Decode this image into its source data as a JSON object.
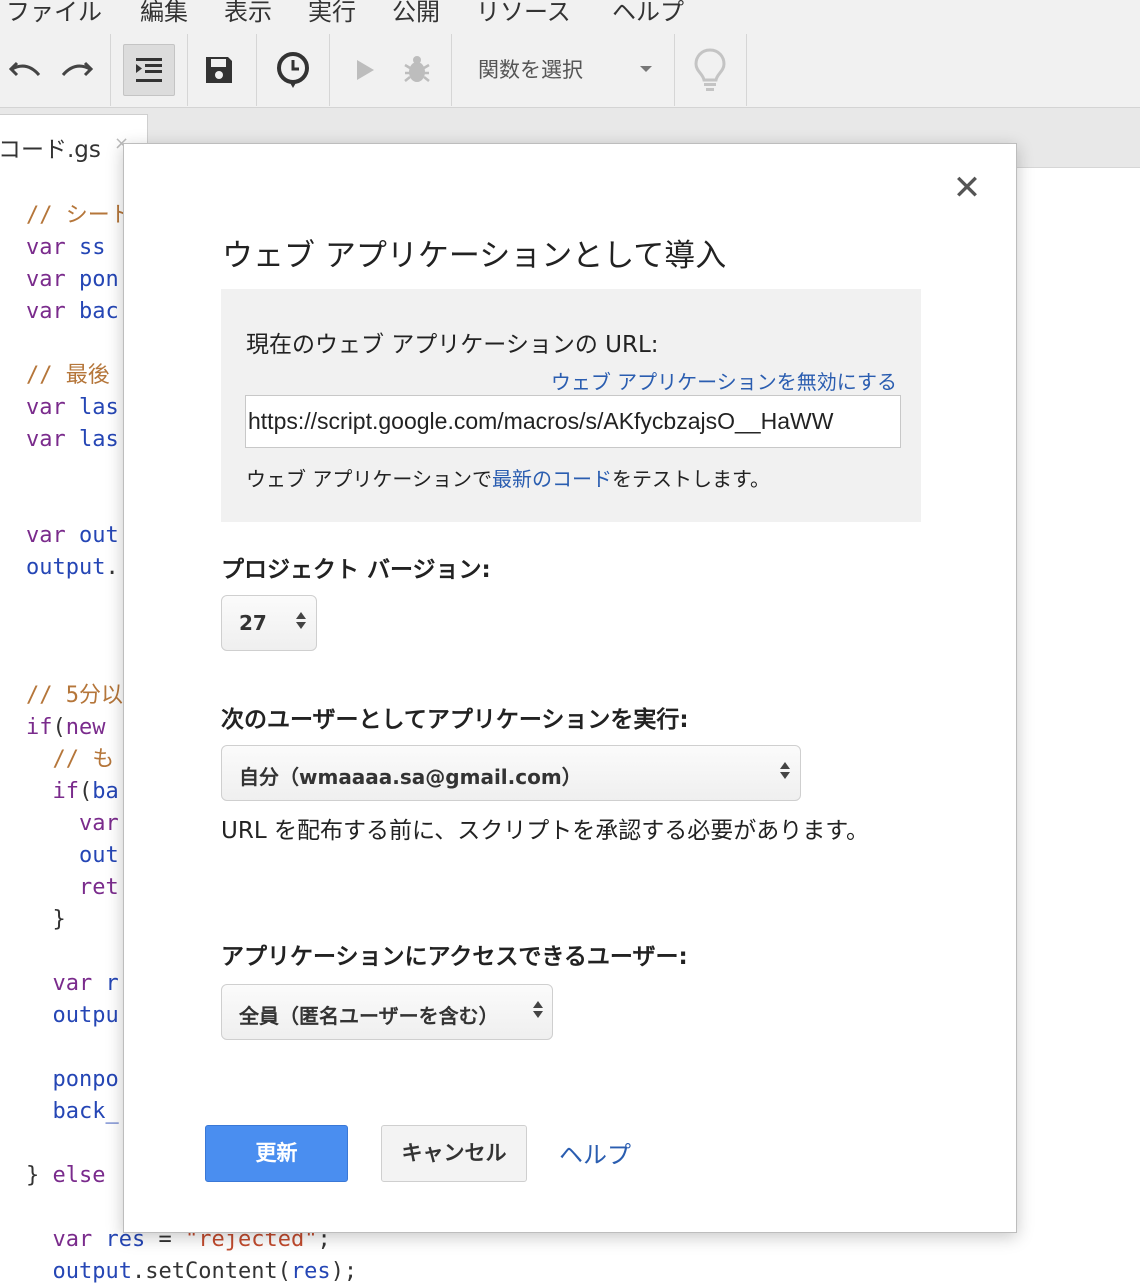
{
  "menubar": {
    "items": [
      "ファイル",
      "編集",
      "表示",
      "実行",
      "公開",
      "リソース",
      "ヘルプ"
    ]
  },
  "toolbar": {
    "function_select_label": "関数を選択",
    "icons": [
      "undo-icon",
      "redo-icon",
      "indent-icon",
      "save-icon",
      "triggers-icon",
      "run-icon",
      "debug-icon",
      "lightbulb-icon"
    ]
  },
  "tabs": {
    "file_tab_label": "コード.gs",
    "close_glyph": "×"
  },
  "code_lines": [
    {
      "text": "// シート",
      "cls": "cm"
    },
    {
      "text": "var ss",
      "cls": "id",
      "kw": "var"
    },
    {
      "text": "var pon",
      "cls": "id",
      "kw": "var"
    },
    {
      "text": "var bac",
      "cls": "id",
      "kw": "var"
    },
    {
      "text": "// 最後",
      "cls": "cm"
    },
    {
      "text": "var las",
      "cls": "id",
      "kw": "var"
    },
    {
      "text": "var las",
      "cls": "id",
      "kw": "var"
    },
    {
      "text": "var out",
      "cls": "id",
      "kw": "var"
    },
    {
      "text": "output.",
      "cls": "id"
    },
    {
      "text": "// 5分以",
      "cls": "cm"
    },
    {
      "text": "if(new",
      "cls": "kw"
    },
    {
      "text": "  // も",
      "cls": "cm"
    },
    {
      "text": "  if(ba",
      "cls": "kw"
    },
    {
      "text": "    var",
      "cls": "kw"
    },
    {
      "text": "    out",
      "cls": "id"
    },
    {
      "text": "    ret",
      "cls": "kw"
    },
    {
      "text": "  }",
      "cls": "pl"
    },
    {
      "text": "  var r",
      "cls": "kw"
    },
    {
      "text": "  outpu",
      "cls": "id"
    },
    {
      "text": "  ponpo",
      "cls": "id"
    },
    {
      "text": "  back_",
      "cls": "id"
    },
    {
      "text": "} else",
      "cls": "kw"
    },
    {
      "text": "  var res = \"rejected\";",
      "cls": "mixed1"
    },
    {
      "text": "  output.setContent(res);",
      "cls": "mixed2"
    }
  ],
  "dialog": {
    "close_glyph": "✕",
    "title": "ウェブ アプリケーションとして導入",
    "current_url_label": "現在のウェブ アプリケーションの URL:",
    "disable_link": "ウェブ アプリケーションを無効にする",
    "url_value": "https://script.google.com/macros/s/AKfycbzajsO__HaWW",
    "test_prefix": "ウェブ アプリケーションで",
    "test_link": "最新のコード",
    "test_suffix": "をテストします。",
    "project_version_label": "プロジェクト バージョン:",
    "project_version_value": "27",
    "execute_as_label": "次のユーザーとしてアプリケーションを実行:",
    "execute_as_value": "自分（wmaaaa.sa@gmail.com）",
    "approve_note": "URL を配布する前に、スクリプトを承認する必要があります。",
    "access_label": "アプリケーションにアクセスできるユーザー:",
    "access_value": "全員（匿名ユーザーを含む）",
    "update_button": "更新",
    "cancel_button": "キャンセル",
    "help_link": "ヘルプ"
  },
  "colors": {
    "primary_button": "#4a8ef0",
    "link": "#2a5db0",
    "keyword": "#7a2b8c",
    "identifier": "#2546b5",
    "comment": "#b5763a",
    "string": "#c24b2e"
  }
}
